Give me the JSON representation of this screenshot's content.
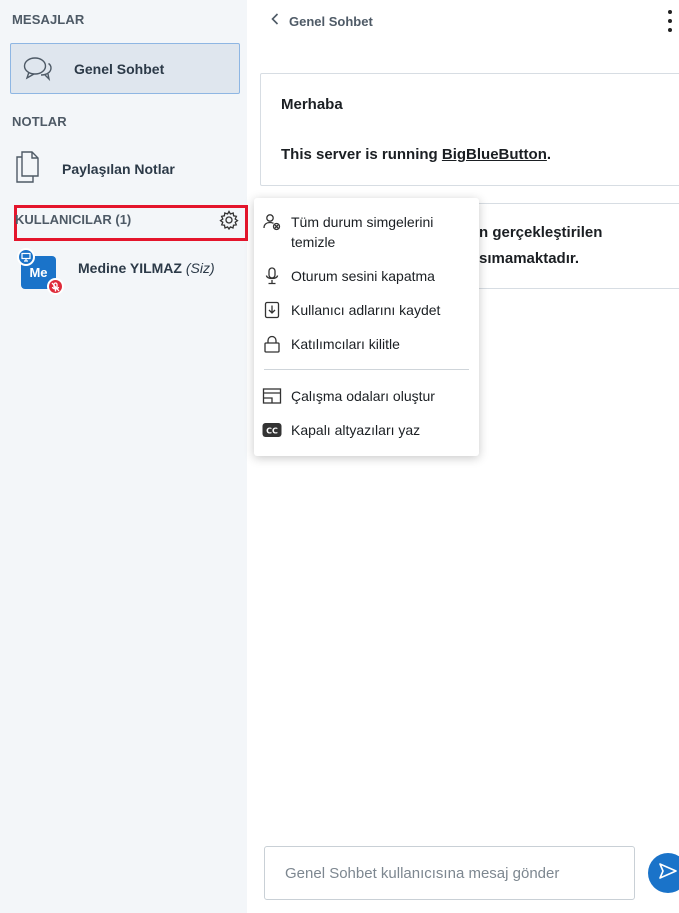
{
  "sidebar": {
    "messages_title": "MESAJLAR",
    "chat_item": {
      "label": "Genel Sohbet",
      "icon": "chat-bubbles-icon"
    },
    "notes_title": "NOTLAR",
    "notes_item": {
      "label": "Paylaşılan Notlar",
      "icon": "document-icon"
    },
    "users_title": "KULLANICILAR (1)",
    "users": [
      {
        "initials": "Me",
        "name": "Medine YILMAZ",
        "you_suffix": "(Siz)"
      }
    ]
  },
  "chat": {
    "header_title": "Genel Sohbet",
    "welcome_line1": "Merhaba",
    "welcome_line2_prefix": "This server is running ",
    "welcome_link": "BigBlueButton",
    "welcome_line2_suffix": ".",
    "notice_line1": "n gerçekleştirilen",
    "notice_line2": "sımamaktadır.",
    "input_placeholder": "Genel Sohbet kullanıcısına mesaj gönder"
  },
  "menu": {
    "items": [
      {
        "label": "Tüm durum simgelerini temizle",
        "icon": "clear-status-icon"
      },
      {
        "label": "Oturum sesini kapatma",
        "icon": "microphone-icon"
      },
      {
        "label": "Kullanıcı adlarını kaydet",
        "icon": "download-icon"
      },
      {
        "label": "Katılımcıları kilitle",
        "icon": "lock-icon"
      },
      {
        "label": "Çalışma odaları oluştur",
        "icon": "breakout-rooms-icon"
      },
      {
        "label": "Kapalı altyazıları yaz",
        "icon": "closed-captions-icon"
      }
    ]
  },
  "colors": {
    "accent": "#1a73c9",
    "highlight_border": "#e4152c",
    "sidebar_bg": "#f3f6f9",
    "muted_badge": "#df2b3a"
  }
}
